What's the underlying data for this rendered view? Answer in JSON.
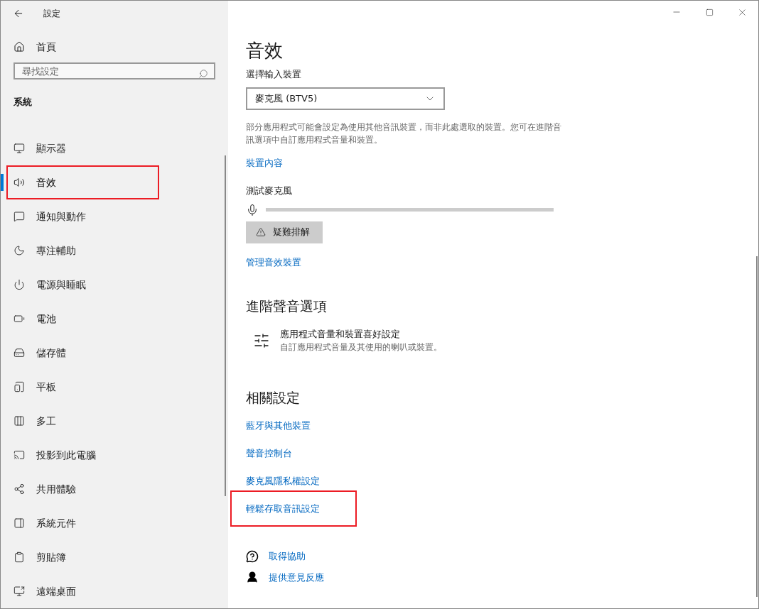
{
  "window": {
    "title": "設定"
  },
  "sidebar": {
    "home": "首頁",
    "search": {
      "placeholder": "尋找設定"
    },
    "section": "系統",
    "items": [
      {
        "label": "顯示器",
        "selected": false,
        "highlighted": false
      },
      {
        "label": "音效",
        "selected": true,
        "highlighted": true
      },
      {
        "label": "通知與動作",
        "selected": false,
        "highlighted": false
      },
      {
        "label": "專注輔助",
        "selected": false,
        "highlighted": false
      },
      {
        "label": "電源與睡眠",
        "selected": false,
        "highlighted": false
      },
      {
        "label": "電池",
        "selected": false,
        "highlighted": false
      },
      {
        "label": "儲存體",
        "selected": false,
        "highlighted": false
      },
      {
        "label": "平板",
        "selected": false,
        "highlighted": false
      },
      {
        "label": "多工",
        "selected": false,
        "highlighted": false
      },
      {
        "label": "投影到此電腦",
        "selected": false,
        "highlighted": false
      },
      {
        "label": "共用體驗",
        "selected": false,
        "highlighted": false
      },
      {
        "label": "系統元件",
        "selected": false,
        "highlighted": false
      },
      {
        "label": "剪貼簿",
        "selected": false,
        "highlighted": false
      },
      {
        "label": "遠端桌面",
        "selected": false,
        "highlighted": false
      }
    ]
  },
  "content": {
    "title": "音效",
    "input": {
      "label": "選擇輸入裝置",
      "value": "麥克風 (BTV5)",
      "description": "部分應用程式可能會設定為使用其他音訊裝置，而非此處選取的裝置。您可在進階音訊選項中自訂應用程式音量和裝置。",
      "link": "裝置內容"
    },
    "test": {
      "label": "測試麥克風",
      "level": 0,
      "button": "疑難排解",
      "link": "管理音效裝置"
    },
    "advanced": {
      "title": "進階聲音選項",
      "item_title": "應用程式音量和裝置喜好設定",
      "item_description": "自訂應用程式音量及其使用的喇叭或裝置。"
    },
    "related": {
      "title": "相關設定",
      "links": [
        {
          "label": "藍牙與其他裝置",
          "highlighted": false
        },
        {
          "label": "聲音控制台",
          "highlighted": false
        },
        {
          "label": "麥克風隱私權設定",
          "highlighted": false
        },
        {
          "label": "輕鬆存取音訊設定",
          "highlighted": true
        }
      ]
    },
    "help": [
      {
        "label": "取得協助"
      },
      {
        "label": "提供意見反應"
      }
    ]
  }
}
